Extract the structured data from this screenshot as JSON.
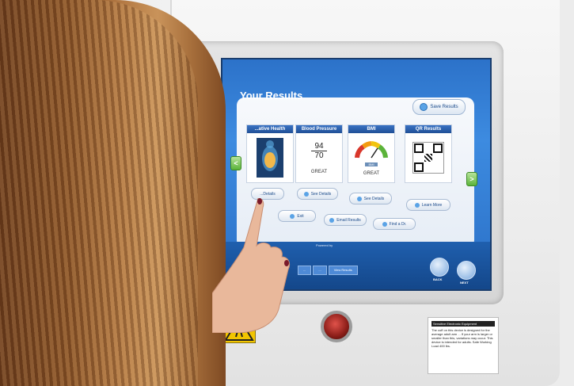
{
  "screen": {
    "title": "Your Results",
    "save_label": "Save Results",
    "cards": [
      {
        "header": "...ative Health",
        "status": "",
        "button": "...Details"
      },
      {
        "header": "Blood Pressure",
        "bp_systolic": "94",
        "bp_diastolic": "70",
        "status": "GREAT",
        "button": "See Details"
      },
      {
        "header": "BMI",
        "gauge_label": "BMI",
        "status": "GREAT",
        "button": "See Details"
      },
      {
        "header": "QR Results",
        "status": "",
        "button": "Learn More"
      }
    ],
    "action_buttons": [
      "Exit",
      "Email Results",
      "Find a Dr."
    ],
    "powered_by": "Powered by",
    "breadcrumbs": [
      "...",
      "...",
      "View Results"
    ],
    "back_label": "BACK",
    "next_label": "NEXT",
    "nav_prev": "<",
    "nav_next": ">"
  },
  "kiosk": {
    "sticker_title": "Sensitive Electronic Equipment",
    "sticker_text": "The cuff on this device is designed for the average adult arm ... If your arm is larger or smaller than this, variations may occur. This device is intended for adults. Safe Working Load 400 lbs."
  },
  "colors": {
    "screen_blue": "#2c72c9",
    "card_header": "#1f4f96",
    "nav_green": "#5bb33a",
    "red_button": "#c0392b"
  }
}
